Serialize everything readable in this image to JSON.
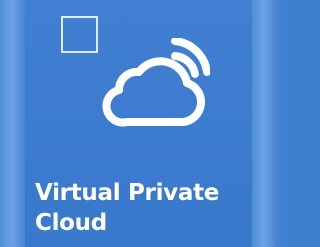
{
  "tile": {
    "label_line1": "Virtual Private",
    "label_line2": "Cloud",
    "icon": "cloud-wifi-icon",
    "checkbox_checked": false,
    "colors": {
      "tile_background": "#3a7bd0",
      "foreground": "#ffffff"
    }
  }
}
